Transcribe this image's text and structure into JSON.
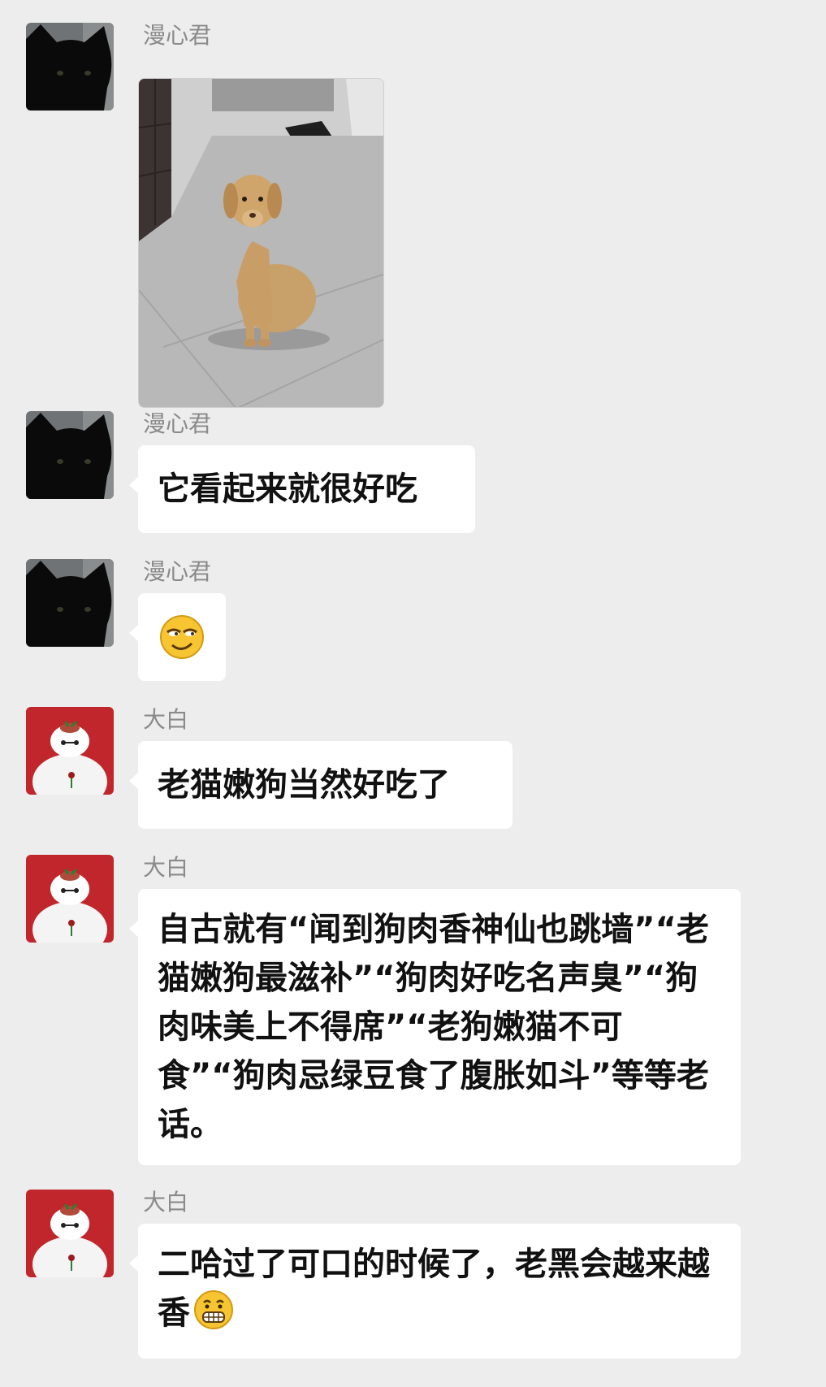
{
  "chat": {
    "messages": [
      {
        "sender": "漫心君",
        "avatar": "black-cat-avatar",
        "type": "image",
        "image_desc": "puppy-photo"
      },
      {
        "sender": "漫心君",
        "avatar": "black-cat-avatar",
        "type": "text",
        "text": "它看起来就很好吃"
      },
      {
        "sender": "漫心君",
        "avatar": "black-cat-avatar",
        "type": "emoji",
        "emoji": "smirk-emoji"
      },
      {
        "sender": "大白",
        "avatar": "baymax-avatar",
        "type": "text",
        "text": "老猫嫩狗当然好吃了"
      },
      {
        "sender": "大白",
        "avatar": "baymax-avatar",
        "type": "text",
        "text": "自古就有“闻到狗肉香神仙也跳墙”“老猫嫩狗最滋补”“狗肉好吃名声臭”“狗肉味美上不得席”“老狗嫩猫不可食”“狗肉忌绿豆食了腹胀如斗”等等老话。"
      },
      {
        "sender": "大白",
        "avatar": "baymax-avatar",
        "type": "text",
        "text": "二哈过了可口的时候了，老黑会越来越香",
        "trailing_emoji": "grimace-emoji"
      }
    ]
  },
  "colors": {
    "background": "#ededed",
    "bubble": "#ffffff",
    "sender_name": "#8a8a8a",
    "text": "#111111",
    "baymax_bg": "#c0262c"
  }
}
